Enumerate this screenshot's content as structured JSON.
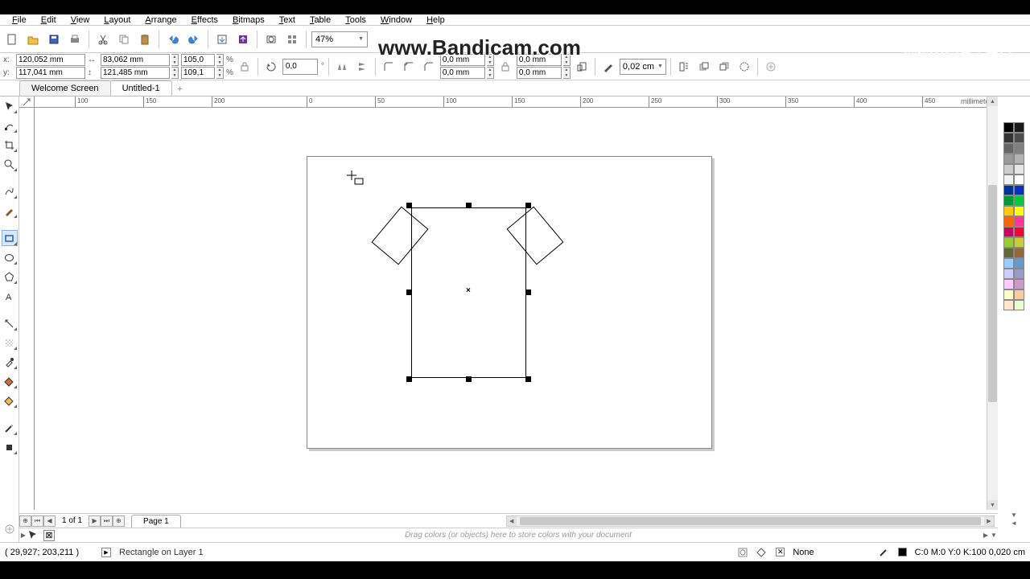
{
  "menu": {
    "file": "File",
    "edit": "Edit",
    "view": "View",
    "layout": "Layout",
    "arrange": "Arrange",
    "effects": "Effects",
    "bitmaps": "Bitmaps",
    "text": "Text",
    "table": "Table",
    "tools": "Tools",
    "window": "Window",
    "help": "Help"
  },
  "toolbar": {
    "zoom": "47%"
  },
  "propbar": {
    "x": "120,052 mm",
    "y": "117,041 mm",
    "w": "83,062 mm",
    "h": "121,485 mm",
    "sx": "105,0",
    "sy": "109,1",
    "rot": "0,0",
    "corner1": "0,0 mm",
    "corner2": "0,0 mm",
    "corner3": "0,0 mm",
    "corner4": "0,0 mm",
    "outline": "0,02 cm"
  },
  "tabs": {
    "welcome": "Welcome Screen",
    "doc": "Untitled-1"
  },
  "ruler": {
    "unit": "millimeters",
    "ticks": [
      "100",
      "150",
      "200",
      "0",
      "50",
      "100",
      "150",
      "200",
      "250",
      "300",
      "350",
      "400",
      "450"
    ]
  },
  "pagebar": {
    "count": "1 of 1",
    "page": "Page 1"
  },
  "docpal": {
    "hint": "Drag colors (or objects) here to store colors with your document"
  },
  "status": {
    "coord": "( 29,927; 203,211 )",
    "obj": "Rectangle on Layer 1",
    "fill": "None",
    "outline": "C:0 M:0 Y:0 K:100  0,020 cm"
  },
  "watermark": {
    "url": "www.Bandicam.com",
    "made": "Made with",
    "brand": "KINEMASTER"
  },
  "palette": [
    "#000000",
    "#1a1a1a",
    "#333333",
    "#4d4d4d",
    "#666666",
    "#808080",
    "#999999",
    "#b3b3b3",
    "#cccccc",
    "#e6e6e6",
    "#f2f2f2",
    "#ffffff",
    "#003399",
    "#0033cc",
    "#009933",
    "#00cc33",
    "#ffcc00",
    "#ffff00",
    "#ff6600",
    "#ff3399",
    "#cc0066",
    "#ff0033",
    "#99cc33",
    "#cccc33",
    "#666633",
    "#996633",
    "#99ccff",
    "#6699cc",
    "#ccccff",
    "#9999cc",
    "#ffccff",
    "#cc99cc",
    "#ffffcc",
    "#ffcc99",
    "#ffe6cc",
    "#e6ffcc"
  ]
}
